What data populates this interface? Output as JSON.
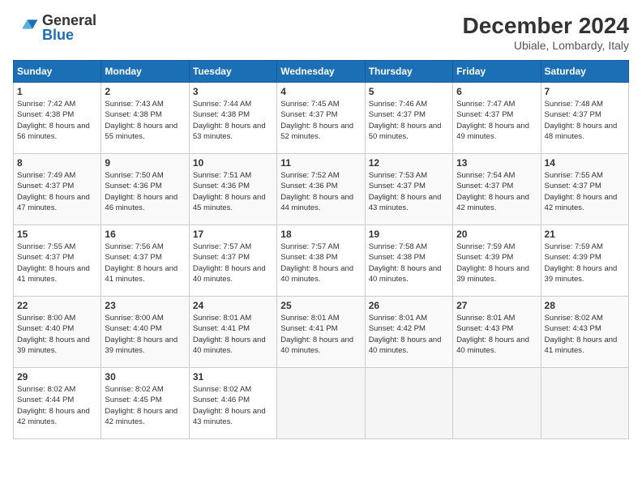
{
  "header": {
    "logo_general": "General",
    "logo_blue": "Blue",
    "main_title": "December 2024",
    "sub_title": "Ubiale, Lombardy, Italy"
  },
  "columns": [
    "Sunday",
    "Monday",
    "Tuesday",
    "Wednesday",
    "Thursday",
    "Friday",
    "Saturday"
  ],
  "rows": [
    [
      {
        "day": "1",
        "sunrise": "Sunrise: 7:42 AM",
        "sunset": "Sunset: 4:38 PM",
        "daylight": "Daylight: 8 hours and 56 minutes."
      },
      {
        "day": "2",
        "sunrise": "Sunrise: 7:43 AM",
        "sunset": "Sunset: 4:38 PM",
        "daylight": "Daylight: 8 hours and 55 minutes."
      },
      {
        "day": "3",
        "sunrise": "Sunrise: 7:44 AM",
        "sunset": "Sunset: 4:38 PM",
        "daylight": "Daylight: 8 hours and 53 minutes."
      },
      {
        "day": "4",
        "sunrise": "Sunrise: 7:45 AM",
        "sunset": "Sunset: 4:37 PM",
        "daylight": "Daylight: 8 hours and 52 minutes."
      },
      {
        "day": "5",
        "sunrise": "Sunrise: 7:46 AM",
        "sunset": "Sunset: 4:37 PM",
        "daylight": "Daylight: 8 hours and 50 minutes."
      },
      {
        "day": "6",
        "sunrise": "Sunrise: 7:47 AM",
        "sunset": "Sunset: 4:37 PM",
        "daylight": "Daylight: 8 hours and 49 minutes."
      },
      {
        "day": "7",
        "sunrise": "Sunrise: 7:48 AM",
        "sunset": "Sunset: 4:37 PM",
        "daylight": "Daylight: 8 hours and 48 minutes."
      }
    ],
    [
      {
        "day": "8",
        "sunrise": "Sunrise: 7:49 AM",
        "sunset": "Sunset: 4:37 PM",
        "daylight": "Daylight: 8 hours and 47 minutes."
      },
      {
        "day": "9",
        "sunrise": "Sunrise: 7:50 AM",
        "sunset": "Sunset: 4:36 PM",
        "daylight": "Daylight: 8 hours and 46 minutes."
      },
      {
        "day": "10",
        "sunrise": "Sunrise: 7:51 AM",
        "sunset": "Sunset: 4:36 PM",
        "daylight": "Daylight: 8 hours and 45 minutes."
      },
      {
        "day": "11",
        "sunrise": "Sunrise: 7:52 AM",
        "sunset": "Sunset: 4:36 PM",
        "daylight": "Daylight: 8 hours and 44 minutes."
      },
      {
        "day": "12",
        "sunrise": "Sunrise: 7:53 AM",
        "sunset": "Sunset: 4:37 PM",
        "daylight": "Daylight: 8 hours and 43 minutes."
      },
      {
        "day": "13",
        "sunrise": "Sunrise: 7:54 AM",
        "sunset": "Sunset: 4:37 PM",
        "daylight": "Daylight: 8 hours and 42 minutes."
      },
      {
        "day": "14",
        "sunrise": "Sunrise: 7:55 AM",
        "sunset": "Sunset: 4:37 PM",
        "daylight": "Daylight: 8 hours and 42 minutes."
      }
    ],
    [
      {
        "day": "15",
        "sunrise": "Sunrise: 7:55 AM",
        "sunset": "Sunset: 4:37 PM",
        "daylight": "Daylight: 8 hours and 41 minutes."
      },
      {
        "day": "16",
        "sunrise": "Sunrise: 7:56 AM",
        "sunset": "Sunset: 4:37 PM",
        "daylight": "Daylight: 8 hours and 41 minutes."
      },
      {
        "day": "17",
        "sunrise": "Sunrise: 7:57 AM",
        "sunset": "Sunset: 4:37 PM",
        "daylight": "Daylight: 8 hours and 40 minutes."
      },
      {
        "day": "18",
        "sunrise": "Sunrise: 7:57 AM",
        "sunset": "Sunset: 4:38 PM",
        "daylight": "Daylight: 8 hours and 40 minutes."
      },
      {
        "day": "19",
        "sunrise": "Sunrise: 7:58 AM",
        "sunset": "Sunset: 4:38 PM",
        "daylight": "Daylight: 8 hours and 40 minutes."
      },
      {
        "day": "20",
        "sunrise": "Sunrise: 7:59 AM",
        "sunset": "Sunset: 4:39 PM",
        "daylight": "Daylight: 8 hours and 39 minutes."
      },
      {
        "day": "21",
        "sunrise": "Sunrise: 7:59 AM",
        "sunset": "Sunset: 4:39 PM",
        "daylight": "Daylight: 8 hours and 39 minutes."
      }
    ],
    [
      {
        "day": "22",
        "sunrise": "Sunrise: 8:00 AM",
        "sunset": "Sunset: 4:40 PM",
        "daylight": "Daylight: 8 hours and 39 minutes."
      },
      {
        "day": "23",
        "sunrise": "Sunrise: 8:00 AM",
        "sunset": "Sunset: 4:40 PM",
        "daylight": "Daylight: 8 hours and 39 minutes."
      },
      {
        "day": "24",
        "sunrise": "Sunrise: 8:01 AM",
        "sunset": "Sunset: 4:41 PM",
        "daylight": "Daylight: 8 hours and 40 minutes."
      },
      {
        "day": "25",
        "sunrise": "Sunrise: 8:01 AM",
        "sunset": "Sunset: 4:41 PM",
        "daylight": "Daylight: 8 hours and 40 minutes."
      },
      {
        "day": "26",
        "sunrise": "Sunrise: 8:01 AM",
        "sunset": "Sunset: 4:42 PM",
        "daylight": "Daylight: 8 hours and 40 minutes."
      },
      {
        "day": "27",
        "sunrise": "Sunrise: 8:01 AM",
        "sunset": "Sunset: 4:43 PM",
        "daylight": "Daylight: 8 hours and 40 minutes."
      },
      {
        "day": "28",
        "sunrise": "Sunrise: 8:02 AM",
        "sunset": "Sunset: 4:43 PM",
        "daylight": "Daylight: 8 hours and 41 minutes."
      }
    ],
    [
      {
        "day": "29",
        "sunrise": "Sunrise: 8:02 AM",
        "sunset": "Sunset: 4:44 PM",
        "daylight": "Daylight: 8 hours and 42 minutes."
      },
      {
        "day": "30",
        "sunrise": "Sunrise: 8:02 AM",
        "sunset": "Sunset: 4:45 PM",
        "daylight": "Daylight: 8 hours and 42 minutes."
      },
      {
        "day": "31",
        "sunrise": "Sunrise: 8:02 AM",
        "sunset": "Sunset: 4:46 PM",
        "daylight": "Daylight: 8 hours and 43 minutes."
      },
      null,
      null,
      null,
      null
    ]
  ]
}
